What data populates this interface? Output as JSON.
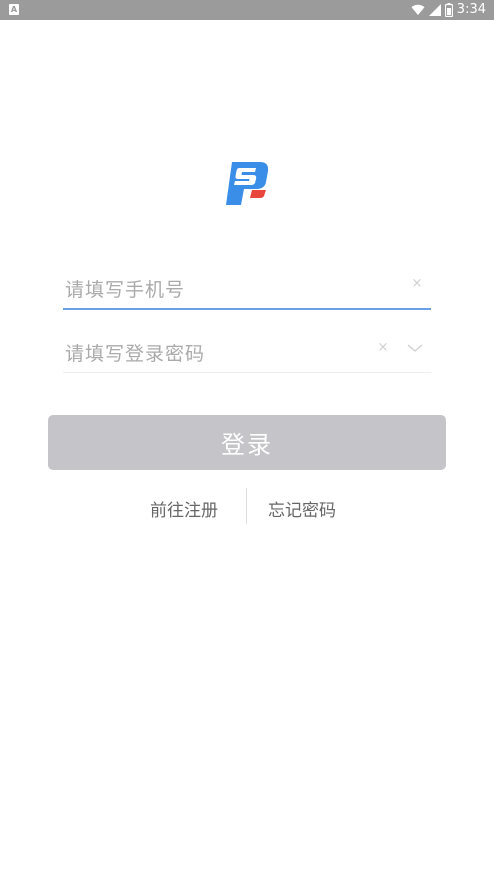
{
  "status_bar": {
    "left_icon": "A",
    "time": "3:34",
    "icons": [
      "wifi-icon",
      "signal-icon",
      "battery-icon"
    ]
  },
  "logo": {
    "name": "sp-logo",
    "colors": {
      "blue": "#3b8ee8",
      "red": "#e8453c"
    }
  },
  "form": {
    "phone_placeholder": "请填写手机号",
    "password_placeholder": "请填写登录密码",
    "clear_glyph": "×"
  },
  "login_button": {
    "label": "登录"
  },
  "links": {
    "register": "前往注册",
    "forgot": "忘记密码"
  },
  "colors": {
    "status_bar": "#9b9b9b",
    "active_underline": "#6aa0e6",
    "button_disabled": "#c4c4c9",
    "placeholder": "#aaaaaa"
  }
}
